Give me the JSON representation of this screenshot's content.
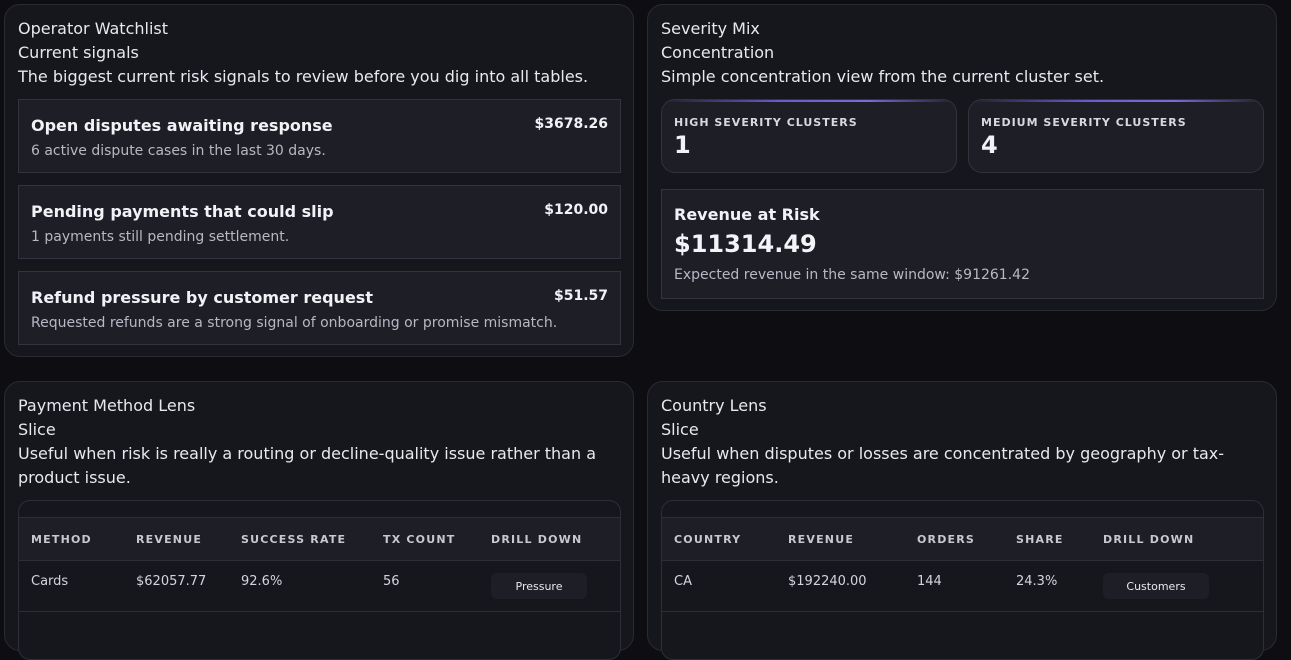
{
  "watchlist": {
    "title": "Operator Watchlist",
    "subtitle": "Current signals",
    "description": "The biggest current risk signals to review before you dig into all tables.",
    "signals": [
      {
        "title": "Open disputes awaiting response",
        "amount": "$3678.26",
        "detail": "6 active dispute cases in the last 30 days."
      },
      {
        "title": "Pending payments that could slip",
        "amount": "$120.00",
        "detail": "1 payments still pending settlement."
      },
      {
        "title": "Refund pressure by customer request",
        "amount": "$51.57",
        "detail": "Requested refunds are a strong signal of onboarding or promise mismatch."
      }
    ]
  },
  "severity": {
    "title": "Severity Mix",
    "subtitle": "Concentration",
    "description": "Simple concentration view from the current cluster set.",
    "stats": [
      {
        "label": "HIGH SEVERITY CLUSTERS",
        "value": "1"
      },
      {
        "label": "MEDIUM SEVERITY CLUSTERS",
        "value": "4"
      }
    ],
    "revenue_at_risk": {
      "title": "Revenue at Risk",
      "value": "$11314.49",
      "detail": "Expected revenue in the same window: $91261.42"
    },
    "accent_color": "#6a5acd"
  },
  "payment_lens": {
    "title": "Payment Method Lens",
    "subtitle": "Slice",
    "description": "Useful when risk is really a routing or decline-quality issue rather than a product issue.",
    "columns": [
      "METHOD",
      "REVENUE",
      "SUCCESS RATE",
      "TX COUNT",
      "DRILL DOWN"
    ],
    "rows": [
      {
        "method": "Cards",
        "revenue": "$62057.77",
        "success_rate": "92.6%",
        "tx_count": "56",
        "drill": "Pressure"
      }
    ]
  },
  "country_lens": {
    "title": "Country Lens",
    "subtitle": "Slice",
    "description": "Useful when disputes or losses are concentrated by geography or tax-heavy regions.",
    "columns": [
      "COUNTRY",
      "REVENUE",
      "ORDERS",
      "SHARE",
      "DRILL DOWN"
    ],
    "rows": [
      {
        "country": "CA",
        "revenue": "$192240.00",
        "orders": "144",
        "share": "24.3%",
        "drill": "Customers"
      }
    ]
  }
}
